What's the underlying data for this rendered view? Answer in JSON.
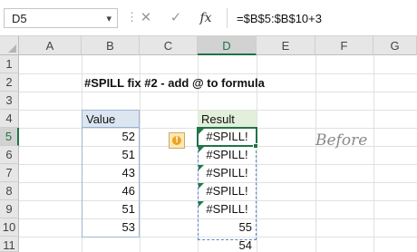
{
  "formula_bar": {
    "name_box": "D5",
    "name_box_dropdown_icon": "chevron-down-icon",
    "separator": "⋮",
    "cancel_symbol": "✕",
    "enter_symbol": "✓",
    "function_symbol": "fx",
    "formula": "=$B$5:$B$10+3"
  },
  "sheet": {
    "columns": [
      "A",
      "B",
      "C",
      "D",
      "E",
      "F",
      "G"
    ],
    "selected_column": "D",
    "rows": [
      "1",
      "2",
      "3",
      "4",
      "5",
      "6",
      "7",
      "8",
      "9",
      "10",
      "11"
    ],
    "selected_row": "5",
    "title": "#SPILL fix #2 - add @ to formula",
    "value_header": "Value",
    "values": [
      "52",
      "51",
      "43",
      "46",
      "51",
      "53"
    ],
    "result_header": "Result",
    "results": [
      "#SPILL!",
      "#SPILL!",
      "#SPILL!",
      "#SPILL!",
      "#SPILL!",
      "55",
      "54"
    ],
    "warning_symbol": "!",
    "note": "Before"
  },
  "colors": {
    "accent_green": "#217346",
    "value_header_fill": "#dce6f1",
    "result_header_fill": "#e2efda",
    "spill_border": "#5b86c6",
    "warning_fill": "#fce8b2"
  }
}
